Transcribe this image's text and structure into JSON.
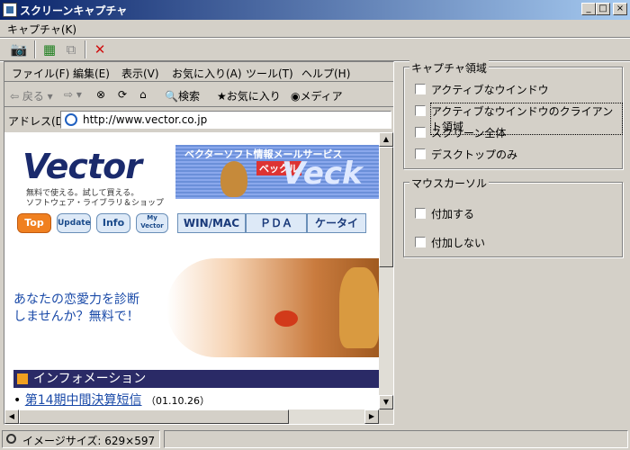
{
  "window": {
    "title": "スクリーンキャプチャ",
    "min": "_",
    "max": "□",
    "close": "×"
  },
  "menu": {
    "capture": "キャプチャ(K)"
  },
  "toolbar": {
    "camera": "📷",
    "select": "▦",
    "window": "⧉",
    "delete": "✕"
  },
  "preview": {
    "ie_menu": [
      "ファイル(F)",
      "編集(E)",
      "表示(V)",
      "お気に入り(A)",
      "ツール(T)",
      "ヘルプ(H)"
    ],
    "ie_tools": {
      "back": "⇦ 戻る ▾",
      "forward": "⇨ ▾",
      "stop": "⊗",
      "refresh": "⟳",
      "home": "⌂",
      "search": "検索",
      "favorites": "お気に入り",
      "media": "メディア"
    },
    "address_label": "アドレス(D)",
    "address": "http://www.vector.co.jp",
    "logo": "Vector",
    "tagline1": "無料で使える。試して買える。",
    "tagline2": "ソフトウェア・ライブラリ＆ショップ",
    "banner_title": "ベクターソフト情報メールサービス",
    "banner_badge": "ベックル",
    "banner_big": "Veck",
    "nav": [
      "Top",
      "Update",
      "Info",
      "My Vector"
    ],
    "tabs": [
      "WIN/MAC",
      "ＰＤＡ",
      "ケータイ"
    ],
    "promo1": "あなたの恋愛力を診断",
    "promo2": "しませんか？無料で！",
    "info_title": "インフォメーション",
    "news_link": "第14期中間決算短信",
    "news_date": "（01.10.26）"
  },
  "capture_area": {
    "title": "キャプチャ領域",
    "options": [
      "アクティブなウインドウ",
      "アクティブなウインドウのクライアント領域",
      "スクリーン全体",
      "デスクトップのみ"
    ],
    "focused": 1
  },
  "cursor": {
    "title": "マウスカーソル",
    "options": [
      "付加する",
      "付加しない"
    ]
  },
  "status": {
    "image_size": "イメージサイズ: 629×597"
  }
}
